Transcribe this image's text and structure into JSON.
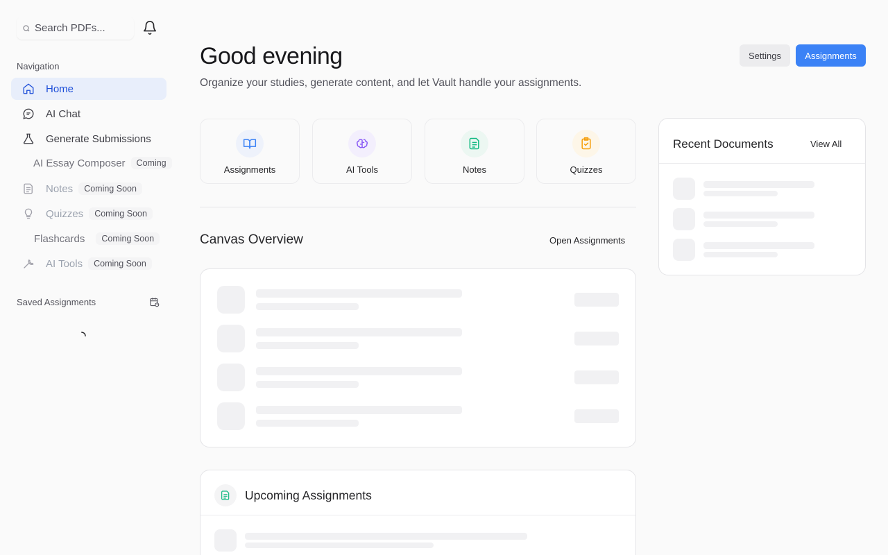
{
  "search": {
    "placeholder": "Search PDFs..."
  },
  "sidebar": {
    "navigation_title": "Navigation",
    "items": [
      {
        "label": "Home"
      },
      {
        "label": "AI Chat"
      },
      {
        "label": "Generate Submissions"
      }
    ],
    "essay": {
      "label": "AI Essay Composer",
      "badge": "Coming"
    },
    "notes": {
      "label": "Notes",
      "badge": "Coming Soon"
    },
    "quizzes": {
      "label": "Quizzes",
      "badge": "Coming Soon"
    },
    "flashcards": {
      "label": "Flashcards",
      "badge": "Coming Soon"
    },
    "tools": {
      "label": "AI Tools",
      "badge": "Coming Soon"
    },
    "saved_title": "Saved Assignments"
  },
  "header": {
    "greeting": "Good evening",
    "subtitle": "Organize your studies, generate content, and let Vault handle your assignments.",
    "settings_label": "Settings",
    "assignments_label": "Assignments"
  },
  "tiles": [
    {
      "label": "Assignments",
      "color": "#3b82f6"
    },
    {
      "label": "AI Tools",
      "color": "#8b5cf6"
    },
    {
      "label": "Notes",
      "color": "#10b981"
    },
    {
      "label": "Quizzes",
      "color": "#f59e0b"
    }
  ],
  "canvas": {
    "title": "Canvas Overview",
    "link": "Open Assignments"
  },
  "recent": {
    "title": "Recent Documents",
    "link": "View All"
  },
  "upcoming": {
    "title": "Upcoming Assignments"
  },
  "colors": {
    "accent": "#3b82f6",
    "active_bg": "#e8eefb",
    "active_text": "#1d4ed8"
  }
}
